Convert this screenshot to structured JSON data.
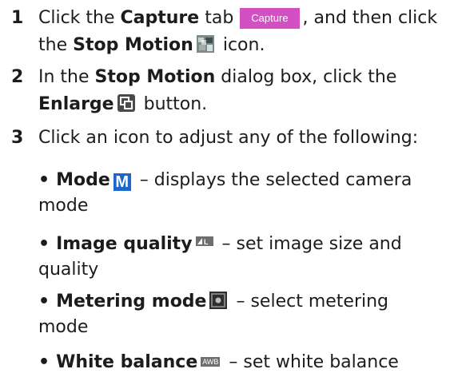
{
  "steps": [
    {
      "number": "1",
      "t1": "Click the ",
      "b1": "Capture",
      "t2": " tab",
      "tab_label": "Capture",
      "t3": ", and then click",
      "t4": "the ",
      "b2": "Stop Motion",
      "t5": " icon.",
      "icon": "stop-motion-icon"
    },
    {
      "number": "2",
      "t1": "In the ",
      "b1": "Stop Motion",
      "t2": " dialog box, click the",
      "b2": "Enlarge",
      "t3": " button.",
      "icon": "enlarge-icon"
    },
    {
      "number": "3",
      "t1": "Click an icon to adjust any of the following:"
    }
  ],
  "bullets": [
    {
      "bold": "Mode",
      "icon": "mode-icon",
      "icon_letter": "M",
      "rest_line1": " – displays the selected camera",
      "rest_line2": "mode"
    },
    {
      "bold": "Image quality",
      "icon": "image-quality-icon",
      "rest_line1": " – set image size and",
      "rest_line2": "quality"
    },
    {
      "bold": "Metering mode",
      "icon": "metering-mode-icon",
      "rest_line1": " – select metering",
      "rest_line2": "mode"
    },
    {
      "bold": "White balance",
      "icon": "white-balance-icon",
      "icon_text": "AWB",
      "rest_line1": " – set white balance",
      "rest_line2": ""
    }
  ],
  "bullet_char": "•",
  "colors": {
    "tab_bg": "#d24fc4",
    "mode_icon_bg": "#1e66c9"
  }
}
